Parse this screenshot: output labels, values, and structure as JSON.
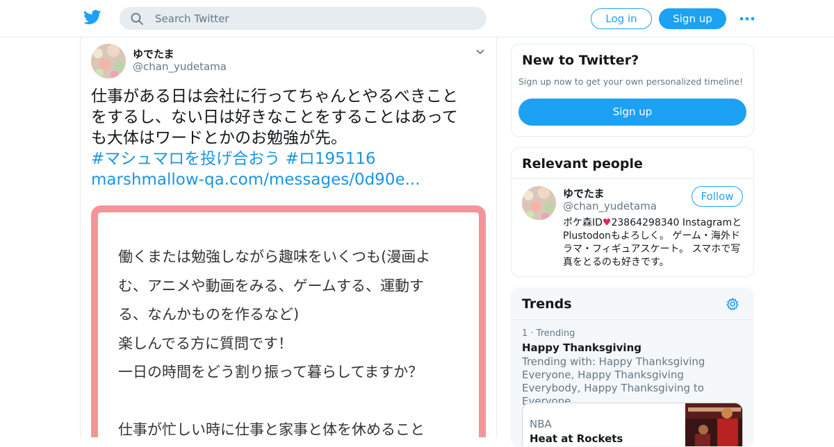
{
  "header": {
    "search_placeholder": "Search Twitter",
    "login_label": "Log in",
    "signup_label": "Sign up"
  },
  "tweet": {
    "display_name": "ゆでたま",
    "handle": "@chan_yudetama",
    "text_lines": [
      "仕事がある日は会社に行ってちゃんとやるべきこと",
      "をするし、ない日は好きなことをすることはあって",
      "も大体はワードとかのお勉強が先。"
    ],
    "hashtags": "#マシュマロを投げ合おう #ロ195116",
    "link": "marshmallow-qa.com/messages/0d90e...",
    "media_lines": [
      "働くまたは勉強しながら趣味をいくつも(漫画よ",
      "む、アニメや動画をみる、ゲームする、運動す",
      "る、なんかものを作るなど)",
      "楽しんでる方に質問です！",
      "一日の時間をどう割り振って暮らしてますか？",
      "",
      "仕事が忙しい時に仕事と家事と体を休めること"
    ]
  },
  "new_to_twitter": {
    "title": "New to Twitter?",
    "subtitle": "Sign up now to get your own personalized timeline!",
    "signup_label": "Sign up"
  },
  "relevant_people": {
    "title": "Relevant people",
    "display_name": "ゆでたま",
    "handle": "@chan_yudetama",
    "follow_label": "Follow",
    "bio_prefix": "ポケ森ID",
    "bio_heart": "♥",
    "bio_rest": "23864298340 Instagramと Plustodonもよろしく。 ゲーム・海外ドラマ・フィギュアスケート。 スマホで写真をとるのも好きです。"
  },
  "trends": {
    "title": "Trends",
    "items": [
      {
        "rank": "1 · Trending",
        "name": "Happy Thanksgiving",
        "trending_with": "Trending with: Happy Thanksgiving Everyone, Happy Thanksgiving Everybody, Happy Thanksgiving to Everyone"
      }
    ],
    "news_category": "NBA",
    "news_headline": "Heat at Rockets"
  },
  "colors": {
    "accent": "#1da1f2",
    "link": "#1b95e0",
    "media_border": "#f29599"
  },
  "icons": [
    "twitter-bird-icon",
    "search-icon",
    "more-icon",
    "chevron-down-icon",
    "gear-icon"
  ]
}
